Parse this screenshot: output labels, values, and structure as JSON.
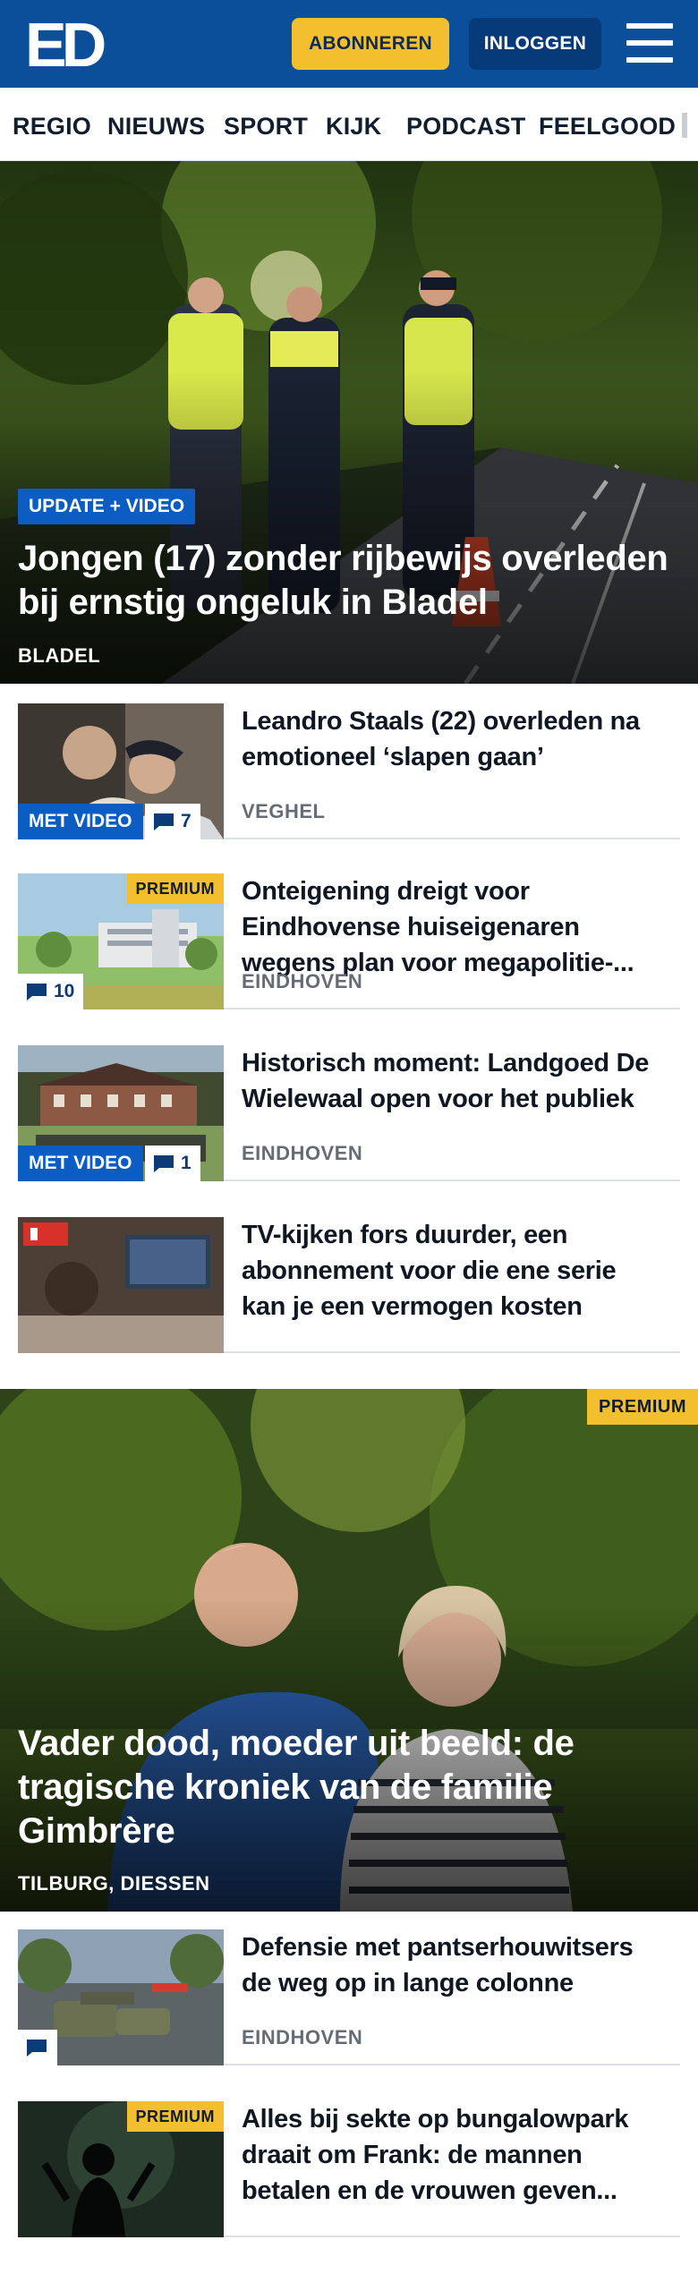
{
  "header": {
    "logo_text": "ED",
    "subscribe_label": "ABONNEREN",
    "login_label": "INLOGGEN",
    "menu_icon": "hamburger-menu-icon",
    "brand_color": "#0b4f9a",
    "accent_color": "#f4bf2e"
  },
  "nav": {
    "items": [
      "REGIO",
      "NIEUWS",
      "SPORT",
      "KIJK",
      "PODCAST",
      "FEELGOOD"
    ]
  },
  "hero1": {
    "badge": "UPDATE + VIDEO",
    "title_line1": "Jongen (17) zonder rijbewijs overleden",
    "title_line2": "bij ernstig ongeluk in Bladel",
    "location": "BLADEL"
  },
  "articles1": [
    {
      "title_line1": "Leandro Staals (22) overleden na",
      "title_line2": "emotioneel ‘slapen gaan’",
      "title_line3": "",
      "location": "VEGHEL",
      "video_label": "MET VIDEO",
      "comments": "7",
      "premium": ""
    },
    {
      "title_line1": "Onteigening dreigt voor",
      "title_line2": "Eindhovense huiseigenaren",
      "title_line3": "wegens plan voor megapolitie-...",
      "location": "EINDHOVEN",
      "video_label": "",
      "comments": "10",
      "premium": "PREMIUM"
    },
    {
      "title_line1": "Historisch moment: Landgoed De",
      "title_line2": "Wielewaal open voor het publiek",
      "title_line3": "",
      "location": "EINDHOVEN",
      "video_label": "MET VIDEO",
      "comments": "1",
      "premium": ""
    },
    {
      "title_line1": "TV-kijken fors duurder, een",
      "title_line2": "abonnement voor die ene serie",
      "title_line3": "kan je een vermogen kosten",
      "location": "",
      "video_label": "",
      "comments": "",
      "premium": ""
    }
  ],
  "hero2": {
    "premium": "PREMIUM",
    "title_line1": "Vader dood, moeder uit beeld: de",
    "title_line2": "tragische kroniek van de familie",
    "title_line3": "Gimbrère",
    "location": "TILBURG, DIESSEN"
  },
  "articles2": [
    {
      "title_line1": "Defensie met pantserhouwitsers",
      "title_line2": "de weg op in lange colonne",
      "title_line3": "",
      "location": "EINDHOVEN",
      "comments": "",
      "premium": ""
    },
    {
      "title_line1": "Alles bij sekte op bungalowpark",
      "title_line2": "draait om Frank: de mannen",
      "title_line3": "betalen en de vrouwen geven...",
      "location": "",
      "comments": "",
      "premium": "PREMIUM"
    }
  ]
}
